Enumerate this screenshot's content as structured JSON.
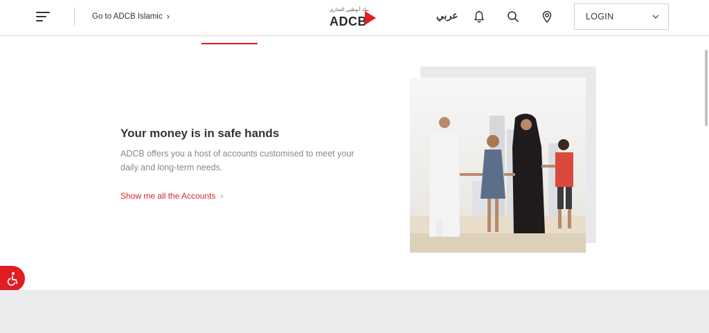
{
  "header": {
    "islamic_link": "Go to  ADCB Islamic",
    "logo_arabic": "بنك أبوظبي التجاري",
    "logo_text": "ADCB",
    "language": "عربي",
    "login_label": "LOGIN"
  },
  "content": {
    "title": "Your money is in safe hands",
    "description": "ADCB offers you a host of accounts customised to meet your daily and long-term needs.",
    "link": "Show me all the Accounts"
  },
  "colors": {
    "brand_red": "#e21c23",
    "link_red": "#d4252b",
    "footer_band": "#ebebee"
  },
  "icons": [
    "menu-icon",
    "chevron-right-icon",
    "adcb-logo",
    "bell-icon",
    "search-icon",
    "location-pin-icon",
    "chevron-down-icon",
    "wheelchair-icon"
  ]
}
